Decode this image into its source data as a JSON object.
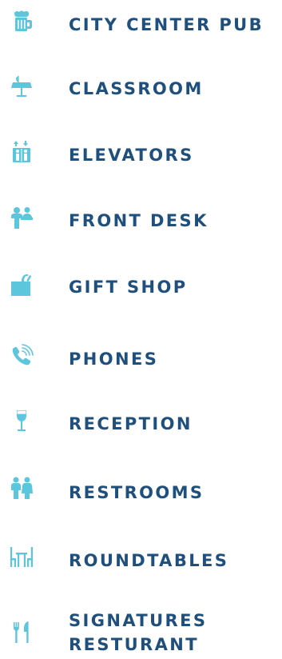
{
  "colors": {
    "label": "#1f4f7c",
    "icon": "#5cc6dc"
  },
  "items": [
    {
      "label": "CITY CENTER PUB",
      "icon": "beer-mug-icon"
    },
    {
      "label": "CLASSROOM",
      "icon": "lectern-icon"
    },
    {
      "label": "ELEVATORS",
      "icon": "elevator-icon"
    },
    {
      "label": "FRONT DESK",
      "icon": "front-desk-icon"
    },
    {
      "label": "GIFT SHOP",
      "icon": "shopping-bag-icon"
    },
    {
      "label": "PHONES",
      "icon": "phone-icon"
    },
    {
      "label": "RECEPTION",
      "icon": "wine-glass-icon"
    },
    {
      "label": "RESTROOMS",
      "icon": "restroom-icon"
    },
    {
      "label": "ROUNDTABLES",
      "icon": "table-chairs-icon"
    },
    {
      "label_line1": "SIGNATURES",
      "label_line2": "RESTURANT",
      "icon": "fork-knife-icon"
    }
  ]
}
